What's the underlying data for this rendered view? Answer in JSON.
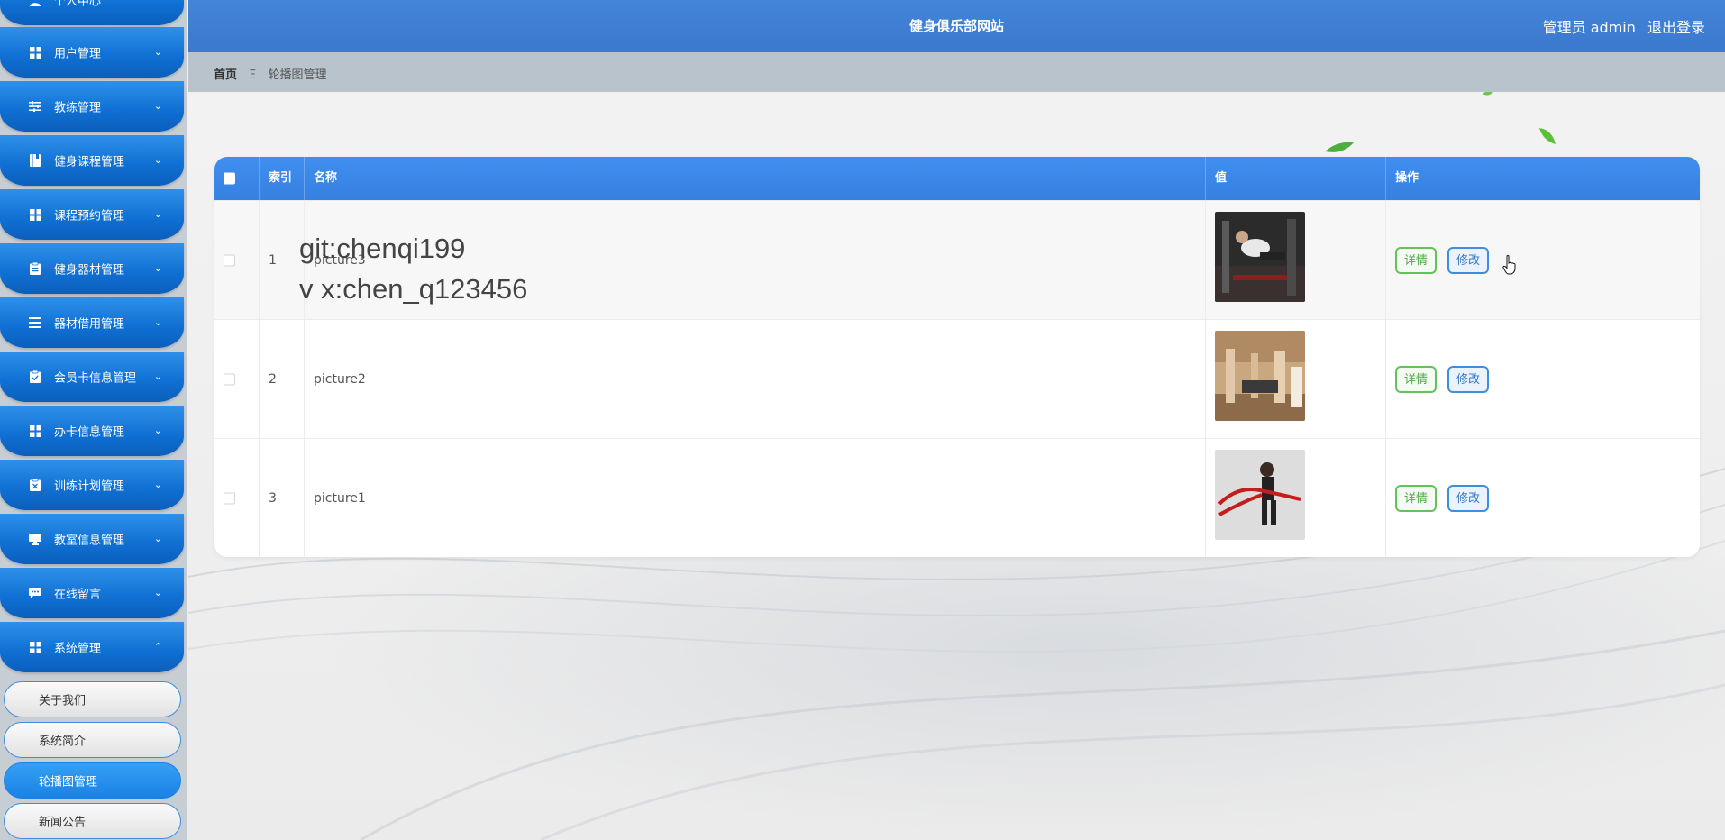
{
  "header": {
    "site_title": "健身俱乐部网站",
    "user_label": "管理员 admin",
    "logout_label": "退出登录"
  },
  "breadcrumb": {
    "home": "首页",
    "separator": "Ξ",
    "current": "轮播图管理"
  },
  "sidebar": {
    "top_partial_label": "个人中心",
    "items": [
      {
        "label": "用户管理",
        "icon": "grid-icon",
        "expanded": false
      },
      {
        "label": "教练管理",
        "icon": "sliders-icon",
        "expanded": false
      },
      {
        "label": "健身课程管理",
        "icon": "book-icon",
        "expanded": false
      },
      {
        "label": "课程预约管理",
        "icon": "grid-icon",
        "expanded": false
      },
      {
        "label": "健身器材管理",
        "icon": "clipboard-icon",
        "expanded": false
      },
      {
        "label": "器材借用管理",
        "icon": "list-icon",
        "expanded": false
      },
      {
        "label": "会员卡信息管理",
        "icon": "clipboard-check-icon",
        "expanded": false
      },
      {
        "label": "办卡信息管理",
        "icon": "grid-icon",
        "expanded": false
      },
      {
        "label": "训练计划管理",
        "icon": "clipboard-x-icon",
        "expanded": false
      },
      {
        "label": "教室信息管理",
        "icon": "monitor-icon",
        "expanded": false
      },
      {
        "label": "在线留言",
        "icon": "chat-icon",
        "expanded": false
      },
      {
        "label": "系统管理",
        "icon": "grid-icon",
        "expanded": true
      }
    ],
    "sub_items": [
      {
        "label": "关于我们",
        "active": false
      },
      {
        "label": "系统简介",
        "active": false
      },
      {
        "label": "轮播图管理",
        "active": true
      },
      {
        "label": "新闻公告",
        "active": false
      }
    ]
  },
  "table": {
    "columns": [
      "索引",
      "名称",
      "值",
      "操作"
    ],
    "rows": [
      {
        "index": "1",
        "name": "picture3",
        "value_image": "gym-photo-1"
      },
      {
        "index": "2",
        "name": "picture2",
        "value_image": "gym-photo-2"
      },
      {
        "index": "3",
        "name": "picture1",
        "value_image": "gym-photo-3"
      }
    ],
    "detail_label": "详情",
    "edit_label": "修改"
  },
  "watermark": {
    "line1": "git:chenqi199",
    "line2": "v x:chen_q123456"
  },
  "colors": {
    "header_bg": "#3b78cf",
    "menu_blue": "#0f6fd2",
    "active_sub": "#1a82e6",
    "detail_green": "#52a84b",
    "edit_blue": "#3879c7"
  }
}
